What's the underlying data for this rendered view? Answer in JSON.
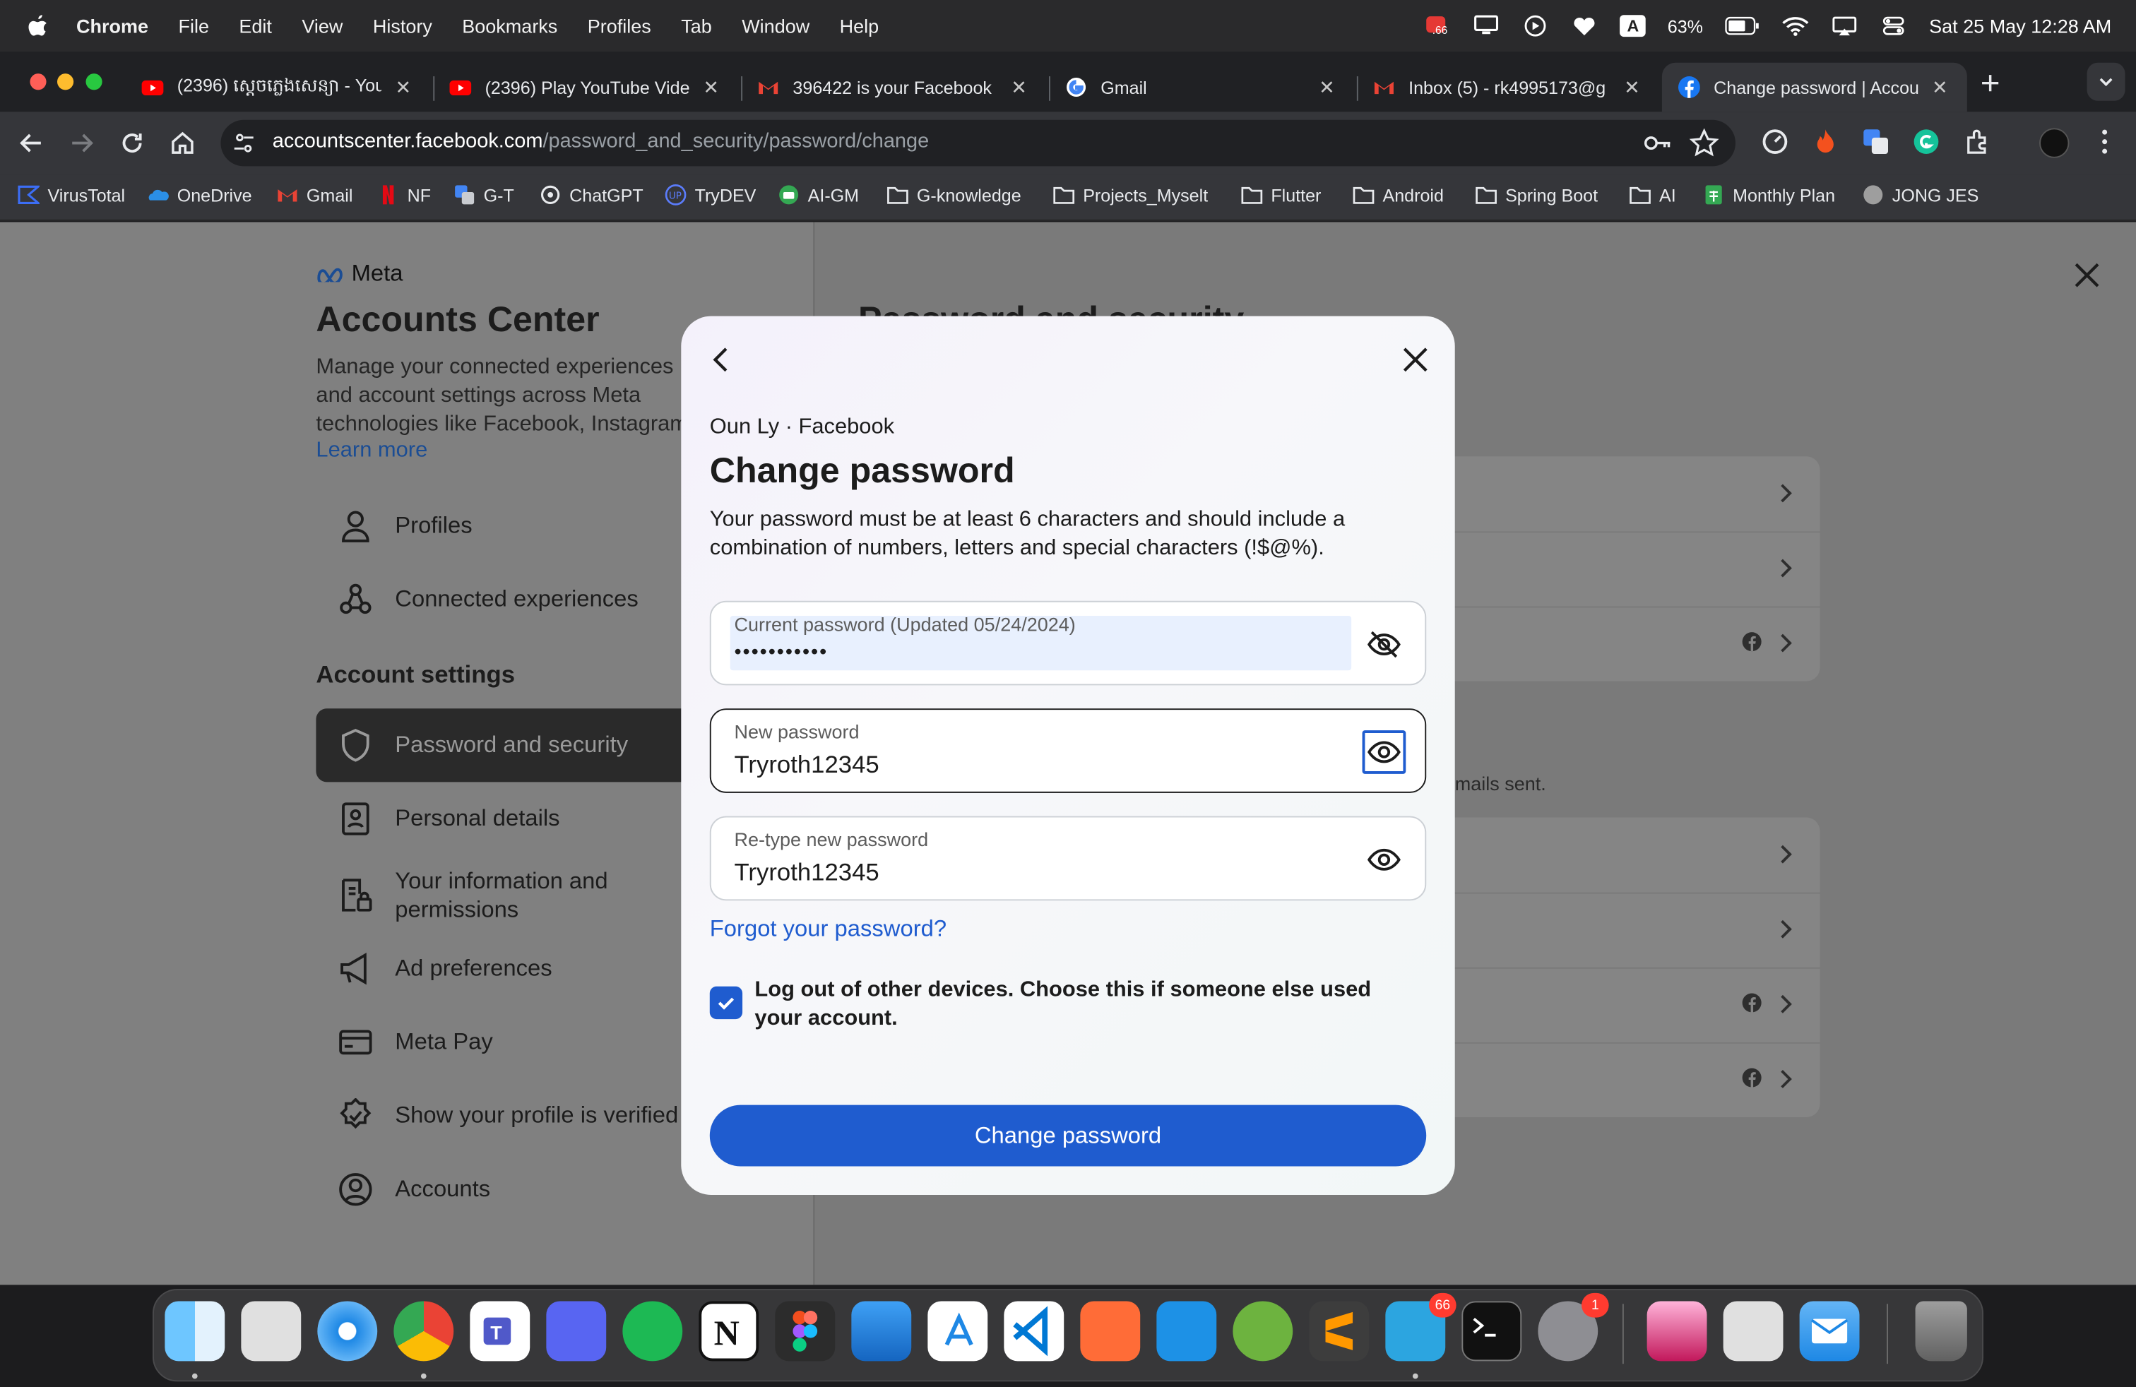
{
  "menubar": {
    "app": "Chrome",
    "items": [
      "File",
      "Edit",
      "View",
      "History",
      "Bookmarks",
      "Profiles",
      "Tab",
      "Window",
      "Help"
    ],
    "battery": "63%",
    "datetime": "Sat 25 May  12:28 AM",
    "input_letter": "A",
    "badge_value": ".66"
  },
  "tabs": [
    {
      "title": "(2396) ស្តេចភ្លេងសេន្យា - YouT",
      "icon": "youtube-icon"
    },
    {
      "title": "(2396) Play YouTube Vide",
      "icon": "youtube-icon"
    },
    {
      "title": "396422 is your Facebook",
      "icon": "gmail-icon"
    },
    {
      "title": "Gmail",
      "icon": "google-icon"
    },
    {
      "title": "Inbox (5) - rk4995173@g",
      "icon": "gmail-icon"
    },
    {
      "title": "Change password | Accou",
      "icon": "facebook-icon",
      "active": true
    }
  ],
  "address": {
    "host": "accountscenter.facebook.com",
    "path": "/password_and_security/password/change"
  },
  "bookmarks": [
    "VirusTotal",
    "OneDrive",
    "Gmail",
    "NF",
    "G-T",
    "ChatGPT",
    "TryDEV",
    "AI-GM",
    "G-knowledge",
    "Projects_Myselt",
    "Flutter",
    "Android",
    "Spring Boot",
    "AI",
    "Monthly Plan",
    "JONG JES"
  ],
  "sidebar": {
    "logo": "Meta",
    "title": "Accounts Center",
    "description": "Manage your connected experiences and account settings across Meta technologies like Facebook, Instagram and Meta Horizon.",
    "learn_more": "Learn more",
    "top_items": [
      {
        "label": "Profiles",
        "icon": "person-icon"
      },
      {
        "label": "Connected experiences",
        "icon": "connected-icon"
      }
    ],
    "section_title": "Account settings",
    "items": [
      {
        "label": "Password and security",
        "icon": "shield-icon",
        "active": true
      },
      {
        "label": "Personal details",
        "icon": "id-card-icon"
      },
      {
        "label": "Your information and permissions",
        "icon": "info-lock-icon"
      },
      {
        "label": "Ad preferences",
        "icon": "megaphone-icon"
      },
      {
        "label": "Meta Pay",
        "icon": "card-icon"
      },
      {
        "label": "Show your profile is verified",
        "icon": "verified-icon"
      },
      {
        "label": "Accounts",
        "icon": "account-circle-icon"
      }
    ]
  },
  "main": {
    "heading_fragment": "Password and security",
    "emails_fragment": "mails sent."
  },
  "modal": {
    "account": "Oun Ly · Facebook",
    "title": "Change password",
    "description": "Your password must be at least 6 characters and should include a combination of numbers, letters and special characters (!$@%).",
    "current": {
      "label": "Current password (Updated 05/24/2024)",
      "value": "•••••••••••"
    },
    "new": {
      "label": "New password",
      "value": "Tryroth12345"
    },
    "retype": {
      "label": "Re-type new password",
      "value": "Tryroth12345"
    },
    "forgot": "Forgot your password?",
    "logout_checkbox": {
      "label": "Log out of other devices. Choose this if someone else used your account.",
      "checked": true
    },
    "submit": "Change password"
  },
  "dock": {
    "apps": [
      "Finder",
      "Launchpad",
      "Safari",
      "Chrome",
      "Teams",
      "Discord",
      "Spotify",
      "Notion",
      "Figma",
      "Xcode",
      "App Store",
      "VS Code",
      "Postman",
      "Docker",
      "Spring",
      "Sublime Text",
      "Telegram",
      "Terminal",
      "System Settings",
      "Preview",
      "Archive Utility",
      "Mail",
      "Trash"
    ],
    "telegram_badge": "66",
    "settings_badge": "1"
  },
  "colors": {
    "accent": "#1f5ccf",
    "overlay": "#7c7c7c"
  }
}
